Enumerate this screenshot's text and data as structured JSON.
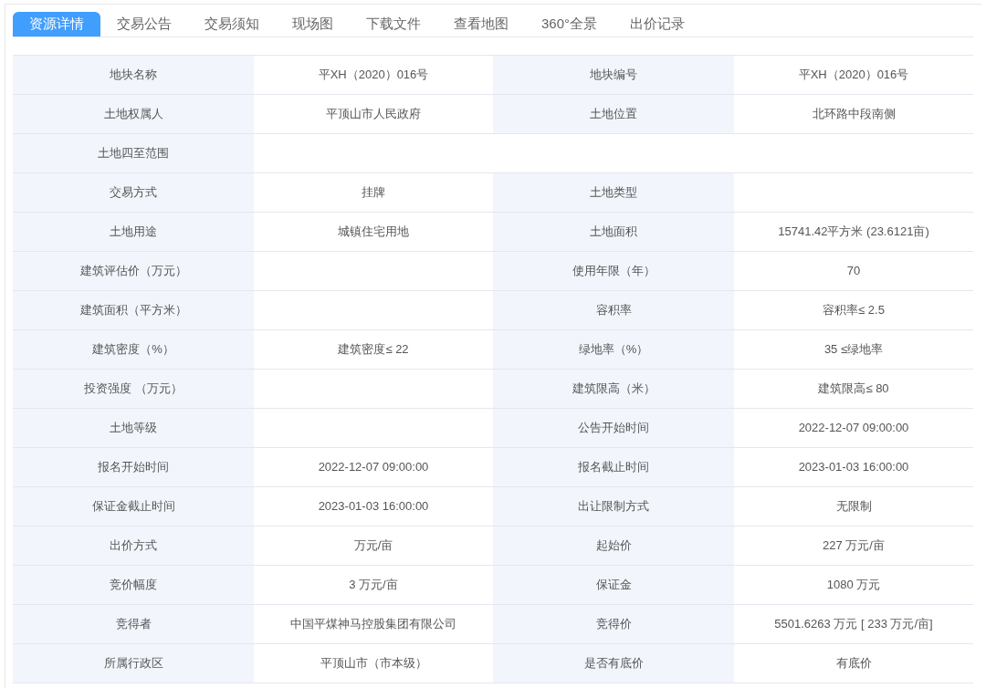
{
  "tabs": [
    {
      "label": "资源详情",
      "selected": true
    },
    {
      "label": "交易公告",
      "selected": false
    },
    {
      "label": "交易须知",
      "selected": false
    },
    {
      "label": "现场图",
      "selected": false
    },
    {
      "label": "下载文件",
      "selected": false
    },
    {
      "label": "查看地图",
      "selected": false
    },
    {
      "label": "360°全景",
      "selected": false
    },
    {
      "label": "出价记录",
      "selected": false
    }
  ],
  "rows": [
    {
      "fields": [
        {
          "label": "地块名称",
          "value": "平XH（2020）016号"
        },
        {
          "label": "地块编号",
          "value": "平XH（2020）016号"
        }
      ]
    },
    {
      "fields": [
        {
          "label": "土地权属人",
          "value": "平顶山市人民政府"
        },
        {
          "label": "土地位置",
          "value": "北环路中段南侧"
        }
      ]
    },
    {
      "fields": [
        {
          "label": "土地四至范围"
        }
      ]
    },
    {
      "fields": [
        {
          "label": "交易方式",
          "value": "挂牌"
        },
        {
          "label": "土地类型"
        }
      ]
    },
    {
      "fields": [
        {
          "label": "土地用途",
          "value": "城镇住宅用地"
        },
        {
          "label": "土地面积",
          "value": "15741.42平方米 (23.6121亩)"
        }
      ]
    },
    {
      "fields": [
        {
          "label": "建筑评估价（万元）"
        },
        {
          "label": "使用年限（年）",
          "value": "70"
        }
      ]
    },
    {
      "fields": [
        {
          "label": "建筑面积（平方米）"
        },
        {
          "label": "容积率",
          "value": "容积率≤ 2.5"
        }
      ]
    },
    {
      "fields": [
        {
          "label": "建筑密度（%）",
          "value": "建筑密度≤ 22"
        },
        {
          "label": "绿地率（%）",
          "value": "35 ≤绿地率"
        }
      ]
    },
    {
      "fields": [
        {
          "label": "投资强度 （万元）"
        },
        {
          "label": "建筑限高（米）",
          "value": "建筑限高≤ 80"
        }
      ]
    },
    {
      "fields": [
        {
          "label": "土地等级"
        },
        {
          "label": "公告开始时间",
          "value": "2022-12-07 09:00:00"
        }
      ]
    },
    {
      "fields": [
        {
          "label": "报名开始时间",
          "value": "2022-12-07 09:00:00"
        },
        {
          "label": "报名截止时间",
          "value": "2023-01-03 16:00:00"
        }
      ]
    },
    {
      "fields": [
        {
          "label": "保证金截止时间",
          "value": "2023-01-03 16:00:00"
        },
        {
          "label": "出让限制方式",
          "value": "无限制"
        }
      ]
    },
    {
      "fields": [
        {
          "label": "出价方式",
          "value": "万元/亩"
        },
        {
          "label": "起始价",
          "value": "227 万元/亩"
        }
      ]
    },
    {
      "fields": [
        {
          "label": "竞价幅度",
          "value": "3 万元/亩"
        },
        {
          "label": "保证金",
          "value": "1080 万元"
        }
      ]
    },
    {
      "fields": [
        {
          "label": "竞得者",
          "value": "中国平煤神马控股集团有限公司"
        },
        {
          "label": "竞得价",
          "value": "5501.6263 万元 [ 233 万元/亩]"
        }
      ]
    },
    {
      "fields": [
        {
          "label": "所属行政区",
          "value": "平顶山市（市本级）"
        },
        {
          "label": "是否有底价",
          "value": "有底价"
        }
      ]
    }
  ]
}
